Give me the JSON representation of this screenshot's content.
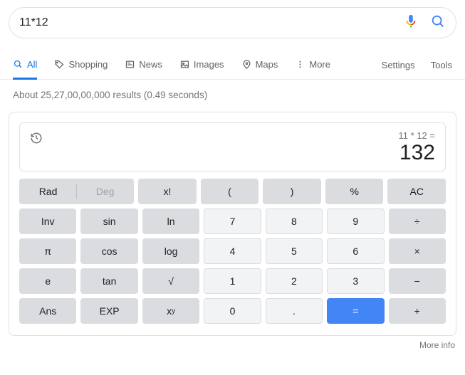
{
  "search": {
    "query": "11*12"
  },
  "tabs": {
    "all": "All",
    "shopping": "Shopping",
    "news": "News",
    "images": "Images",
    "maps": "Maps",
    "more": "More",
    "settings": "Settings",
    "tools": "Tools"
  },
  "result_stats": "About 25,27,00,00,000 results (0.49 seconds)",
  "calculator": {
    "expression": "11 * 12 =",
    "result": "132",
    "buttons": {
      "rad": "Rad",
      "deg": "Deg",
      "fact": "x!",
      "lparen": "(",
      "rparen": ")",
      "percent": "%",
      "ac": "AC",
      "inv": "Inv",
      "sin": "sin",
      "ln": "ln",
      "n7": "7",
      "n8": "8",
      "n9": "9",
      "div": "÷",
      "pi": "π",
      "cos": "cos",
      "log": "log",
      "n4": "4",
      "n5": "5",
      "n6": "6",
      "mul": "×",
      "e": "e",
      "tan": "tan",
      "sqrt": "√",
      "n1": "1",
      "n2": "2",
      "n3": "3",
      "sub": "−",
      "ans": "Ans",
      "exp": "EXP",
      "n0": "0",
      "dot": ".",
      "eq": "=",
      "add": "+"
    }
  },
  "more_info": "More info"
}
